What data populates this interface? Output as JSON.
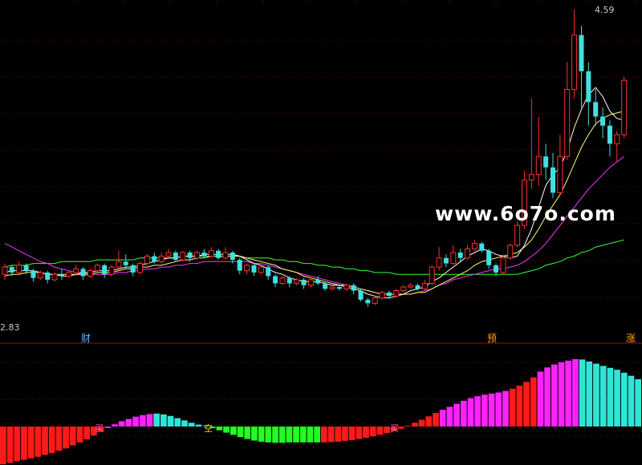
{
  "watermark": "www.6o7o.com",
  "labels": {
    "high": "4.59",
    "low": "2.83",
    "tag_cai": "财",
    "tag_yu": "预",
    "tag_zhang": "涨",
    "signal_buy_1": "买",
    "signal_empty": "空",
    "signal_buy_2": "买"
  },
  "colors": {
    "background": "#000000",
    "up": "#ff3030",
    "down": "#40e0e0",
    "ma_short": "#ffffff",
    "ma_mid": "#ffff66",
    "ma_long": "#ff33ff",
    "ma_very_long": "#33ff33",
    "separator": "#b00000",
    "gridline": "#800000",
    "bar_red": "#ff1a1a",
    "bar_magenta": "#ff22ff",
    "bar_cyan": "#2ee6d6",
    "bar_green": "#22ff22"
  },
  "chart_data": [
    {
      "type": "candlestick",
      "y_range": [
        2.83,
        4.59
      ],
      "grid": "dotted horizontal",
      "candles": [
        [
          3.13,
          3.17,
          3.19,
          3.1
        ],
        [
          3.17,
          3.14,
          3.18,
          3.12
        ],
        [
          3.14,
          3.18,
          3.2,
          3.13
        ],
        [
          3.18,
          3.15,
          3.19,
          3.13
        ],
        [
          3.15,
          3.11,
          3.16,
          3.09
        ],
        [
          3.11,
          3.14,
          3.15,
          3.1
        ],
        [
          3.14,
          3.1,
          3.15,
          3.08
        ],
        [
          3.1,
          3.13,
          3.14,
          3.09
        ],
        [
          3.13,
          3.12,
          3.16,
          3.1
        ],
        [
          3.12,
          3.14,
          3.15,
          3.11
        ],
        [
          3.14,
          3.16,
          3.18,
          3.12
        ],
        [
          3.16,
          3.12,
          3.17,
          3.1
        ],
        [
          3.12,
          3.15,
          3.16,
          3.11
        ],
        [
          3.15,
          3.18,
          3.19,
          3.14
        ],
        [
          3.18,
          3.13,
          3.19,
          3.11
        ],
        [
          3.13,
          3.17,
          3.18,
          3.12
        ],
        [
          3.17,
          3.2,
          3.26,
          3.15
        ],
        [
          3.2,
          3.18,
          3.24,
          3.16
        ],
        [
          3.18,
          3.14,
          3.19,
          3.12
        ],
        [
          3.14,
          3.19,
          3.2,
          3.13
        ],
        [
          3.19,
          3.23,
          3.24,
          3.18
        ],
        [
          3.23,
          3.2,
          3.25,
          3.19
        ],
        [
          3.2,
          3.23,
          3.25,
          3.19
        ],
        [
          3.23,
          3.25,
          3.27,
          3.22
        ],
        [
          3.25,
          3.21,
          3.26,
          3.2
        ],
        [
          3.21,
          3.25,
          3.26,
          3.2
        ],
        [
          3.25,
          3.22,
          3.26,
          3.2
        ],
        [
          3.22,
          3.25,
          3.26,
          3.21
        ],
        [
          3.25,
          3.23,
          3.27,
          3.22
        ],
        [
          3.23,
          3.26,
          3.28,
          3.22
        ],
        [
          3.26,
          3.22,
          3.27,
          3.21
        ],
        [
          3.22,
          3.25,
          3.28,
          3.21
        ],
        [
          3.25,
          3.21,
          3.26,
          3.19
        ],
        [
          3.21,
          3.15,
          3.22,
          3.13
        ],
        [
          3.15,
          3.18,
          3.19,
          3.13
        ],
        [
          3.18,
          3.14,
          3.19,
          3.12
        ],
        [
          3.14,
          3.17,
          3.18,
          3.13
        ],
        [
          3.17,
          3.12,
          3.18,
          3.1
        ],
        [
          3.12,
          3.08,
          3.13,
          3.06
        ],
        [
          3.08,
          3.11,
          3.12,
          3.07
        ],
        [
          3.11,
          3.08,
          3.12,
          3.06
        ],
        [
          3.08,
          3.1,
          3.11,
          3.07
        ],
        [
          3.1,
          3.07,
          3.11,
          3.05
        ],
        [
          3.07,
          3.1,
          3.11,
          3.06
        ],
        [
          3.1,
          3.08,
          3.12,
          3.07
        ],
        [
          3.08,
          3.05,
          3.09,
          3.04
        ],
        [
          3.05,
          3.06,
          3.07,
          3.04
        ],
        [
          3.06,
          3.05,
          3.07,
          3.04
        ],
        [
          3.05,
          3.07,
          3.08,
          3.04
        ],
        [
          3.07,
          3.04,
          3.08,
          3.02
        ],
        [
          3.04,
          2.99,
          3.05,
          2.98
        ],
        [
          2.99,
          2.97,
          3.0,
          2.95
        ],
        [
          2.97,
          3.0,
          3.01,
          2.96
        ],
        [
          3.0,
          3.03,
          3.04,
          2.99
        ],
        [
          3.03,
          3.01,
          3.04,
          3.0
        ],
        [
          3.01,
          3.04,
          3.05,
          3.0
        ],
        [
          3.04,
          3.06,
          3.07,
          3.03
        ],
        [
          3.06,
          3.07,
          3.08,
          3.05
        ],
        [
          3.07,
          3.05,
          3.08,
          3.04
        ],
        [
          3.05,
          3.08,
          3.1,
          3.04
        ],
        [
          3.08,
          3.17,
          3.18,
          3.07
        ],
        [
          3.17,
          3.22,
          3.28,
          3.15
        ],
        [
          3.22,
          3.19,
          3.24,
          3.17
        ],
        [
          3.19,
          3.25,
          3.29,
          3.18
        ],
        [
          3.25,
          3.22,
          3.27,
          3.2
        ],
        [
          3.22,
          3.27,
          3.29,
          3.21
        ],
        [
          3.27,
          3.3,
          3.32,
          3.26
        ],
        [
          3.3,
          3.26,
          3.31,
          3.25
        ],
        [
          3.26,
          3.18,
          3.27,
          3.16
        ],
        [
          3.18,
          3.14,
          3.19,
          3.12
        ],
        [
          3.14,
          3.22,
          3.24,
          3.13
        ],
        [
          3.22,
          3.29,
          3.3,
          3.21
        ],
        [
          3.29,
          3.4,
          3.42,
          3.28
        ],
        [
          3.4,
          3.65,
          3.7,
          3.38
        ],
        [
          3.65,
          3.68,
          4.1,
          3.6
        ],
        [
          3.68,
          3.78,
          4.0,
          3.62
        ],
        [
          3.78,
          3.72,
          3.85,
          3.65
        ],
        [
          3.72,
          3.58,
          3.8,
          3.55
        ],
        [
          3.58,
          3.78,
          3.9,
          3.56
        ],
        [
          3.78,
          4.15,
          4.3,
          3.76
        ],
        [
          4.15,
          4.45,
          4.59,
          4.1
        ],
        [
          4.45,
          4.25,
          4.5,
          4.05
        ],
        [
          4.25,
          4.08,
          4.3,
          3.95
        ],
        [
          4.08,
          4.0,
          4.15,
          3.95
        ],
        [
          4.0,
          3.95,
          4.05,
          3.88
        ],
        [
          3.95,
          3.85,
          3.98,
          3.78
        ],
        [
          3.85,
          3.9,
          3.92,
          3.75
        ],
        [
          3.9,
          4.2,
          4.22,
          3.88
        ]
      ],
      "ma_short": [
        3.14,
        3.15,
        3.15,
        3.15,
        3.15,
        3.14,
        3.13,
        3.13,
        3.12,
        3.12,
        3.13,
        3.14,
        3.14,
        3.15,
        3.15,
        3.15,
        3.16,
        3.17,
        3.17,
        3.18,
        3.19,
        3.2,
        3.21,
        3.22,
        3.22,
        3.23,
        3.23,
        3.23,
        3.24,
        3.24,
        3.24,
        3.24,
        3.24,
        3.23,
        3.21,
        3.19,
        3.18,
        3.16,
        3.14,
        3.13,
        3.11,
        3.1,
        3.09,
        3.09,
        3.09,
        3.08,
        3.07,
        3.07,
        3.06,
        3.05,
        3.04,
        3.02,
        3.01,
        3.0,
        3.0,
        3.01,
        3.02,
        3.04,
        3.05,
        3.06,
        3.09,
        3.11,
        3.14,
        3.17,
        3.2,
        3.23,
        3.25,
        3.27,
        3.26,
        3.24,
        3.23,
        3.22,
        3.23,
        3.29,
        3.38,
        3.5,
        3.62,
        3.68,
        3.72,
        3.81,
        3.94,
        4.04,
        4.12,
        4.16,
        4.11,
        4.03,
        3.99,
        3.98
      ],
      "ma_mid": [
        3.12,
        3.13,
        3.13,
        3.14,
        3.14,
        3.14,
        3.13,
        3.13,
        3.13,
        3.13,
        3.13,
        3.13,
        3.13,
        3.14,
        3.14,
        3.14,
        3.15,
        3.16,
        3.16,
        3.17,
        3.17,
        3.18,
        3.18,
        3.19,
        3.2,
        3.21,
        3.21,
        3.22,
        3.22,
        3.23,
        3.23,
        3.23,
        3.23,
        3.23,
        3.22,
        3.21,
        3.2,
        3.19,
        3.18,
        3.16,
        3.15,
        3.14,
        3.12,
        3.11,
        3.1,
        3.09,
        3.08,
        3.07,
        3.07,
        3.06,
        3.05,
        3.04,
        3.03,
        3.02,
        3.02,
        3.02,
        3.02,
        3.02,
        3.03,
        3.03,
        3.05,
        3.07,
        3.09,
        3.11,
        3.13,
        3.15,
        3.18,
        3.2,
        3.21,
        3.22,
        3.23,
        3.24,
        3.25,
        3.28,
        3.32,
        3.38,
        3.45,
        3.51,
        3.57,
        3.65,
        3.74,
        3.83,
        3.9,
        3.96,
        3.99,
        4.01,
        4.02,
        4.03
      ],
      "ma_long": [
        3.3,
        3.28,
        3.26,
        3.24,
        3.22,
        3.2,
        3.19,
        3.17,
        3.16,
        3.15,
        3.14,
        3.14,
        3.13,
        3.13,
        3.13,
        3.13,
        3.14,
        3.14,
        3.15,
        3.15,
        3.16,
        3.16,
        3.17,
        3.17,
        3.18,
        3.18,
        3.19,
        3.19,
        3.2,
        3.2,
        3.2,
        3.2,
        3.2,
        3.2,
        3.2,
        3.19,
        3.19,
        3.18,
        3.17,
        3.16,
        3.15,
        3.14,
        3.13,
        3.12,
        3.11,
        3.1,
        3.09,
        3.08,
        3.07,
        3.06,
        3.05,
        3.04,
        3.03,
        3.02,
        3.02,
        3.02,
        3.02,
        3.02,
        3.03,
        3.04,
        3.05,
        3.07,
        3.08,
        3.1,
        3.11,
        3.12,
        3.13,
        3.14,
        3.15,
        3.16,
        3.16,
        3.17,
        3.18,
        3.2,
        3.23,
        3.26,
        3.3,
        3.35,
        3.4,
        3.45,
        3.5,
        3.55,
        3.6,
        3.64,
        3.68,
        3.72,
        3.75,
        3.78
      ],
      "ma_very_long": [
        3.17,
        3.18,
        3.18,
        3.18,
        3.19,
        3.19,
        3.19,
        3.19,
        3.2,
        3.2,
        3.2,
        3.2,
        3.2,
        3.21,
        3.21,
        3.21,
        3.21,
        3.21,
        3.21,
        3.22,
        3.22,
        3.22,
        3.22,
        3.22,
        3.22,
        3.23,
        3.23,
        3.23,
        3.23,
        3.23,
        3.23,
        3.23,
        3.23,
        3.23,
        3.22,
        3.22,
        3.22,
        3.22,
        3.21,
        3.21,
        3.2,
        3.2,
        3.19,
        3.19,
        3.18,
        3.18,
        3.17,
        3.17,
        3.16,
        3.16,
        3.15,
        3.15,
        3.14,
        3.14,
        3.14,
        3.13,
        3.13,
        3.13,
        3.13,
        3.13,
        3.13,
        3.13,
        3.13,
        3.13,
        3.13,
        3.13,
        3.13,
        3.13,
        3.13,
        3.13,
        3.13,
        3.13,
        3.13,
        3.14,
        3.15,
        3.16,
        3.18,
        3.19,
        3.2,
        3.22,
        3.23,
        3.25,
        3.26,
        3.28,
        3.29,
        3.3,
        3.31,
        3.32
      ]
    },
    {
      "type": "bar",
      "y_range": [
        -100,
        180
      ],
      "bars": [
        {
          "v": -100,
          "c": "red"
        },
        {
          "v": -96,
          "c": "red"
        },
        {
          "v": -92,
          "c": "red"
        },
        {
          "v": -88,
          "c": "red"
        },
        {
          "v": -84,
          "c": "red"
        },
        {
          "v": -80,
          "c": "red"
        },
        {
          "v": -75,
          "c": "red"
        },
        {
          "v": -70,
          "c": "red"
        },
        {
          "v": -64,
          "c": "red"
        },
        {
          "v": -58,
          "c": "red"
        },
        {
          "v": -50,
          "c": "red"
        },
        {
          "v": -42,
          "c": "red"
        },
        {
          "v": -34,
          "c": "red"
        },
        {
          "v": -24,
          "c": "red"
        },
        {
          "v": -14,
          "c": "red"
        },
        {
          "v": -4,
          "c": "magenta"
        },
        {
          "v": 6,
          "c": "magenta"
        },
        {
          "v": 14,
          "c": "magenta"
        },
        {
          "v": 20,
          "c": "magenta"
        },
        {
          "v": 26,
          "c": "magenta"
        },
        {
          "v": 30,
          "c": "magenta"
        },
        {
          "v": 33,
          "c": "magenta"
        },
        {
          "v": 34,
          "c": "cyan"
        },
        {
          "v": 32,
          "c": "cyan"
        },
        {
          "v": 28,
          "c": "cyan"
        },
        {
          "v": 22,
          "c": "cyan"
        },
        {
          "v": 16,
          "c": "cyan"
        },
        {
          "v": 10,
          "c": "cyan"
        },
        {
          "v": 5,
          "c": "cyan"
        },
        {
          "v": 1,
          "c": "cyan"
        },
        {
          "v": -4,
          "c": "green"
        },
        {
          "v": -10,
          "c": "green"
        },
        {
          "v": -16,
          "c": "green"
        },
        {
          "v": -22,
          "c": "green"
        },
        {
          "v": -28,
          "c": "green"
        },
        {
          "v": -33,
          "c": "green"
        },
        {
          "v": -37,
          "c": "green"
        },
        {
          "v": -40,
          "c": "green"
        },
        {
          "v": -42,
          "c": "green"
        },
        {
          "v": -43,
          "c": "green"
        },
        {
          "v": -43,
          "c": "green"
        },
        {
          "v": -42,
          "c": "green"
        },
        {
          "v": -42,
          "c": "green"
        },
        {
          "v": -42,
          "c": "green"
        },
        {
          "v": -42,
          "c": "green"
        },
        {
          "v": -42,
          "c": "green"
        },
        {
          "v": -42,
          "c": "red"
        },
        {
          "v": -41,
          "c": "red"
        },
        {
          "v": -40,
          "c": "red"
        },
        {
          "v": -38,
          "c": "red"
        },
        {
          "v": -36,
          "c": "red"
        },
        {
          "v": -33,
          "c": "red"
        },
        {
          "v": -30,
          "c": "red"
        },
        {
          "v": -26,
          "c": "red"
        },
        {
          "v": -22,
          "c": "red"
        },
        {
          "v": -17,
          "c": "red"
        },
        {
          "v": -12,
          "c": "red"
        },
        {
          "v": -6,
          "c": "red"
        },
        {
          "v": 2,
          "c": "red"
        },
        {
          "v": 10,
          "c": "red"
        },
        {
          "v": 18,
          "c": "red"
        },
        {
          "v": 27,
          "c": "red"
        },
        {
          "v": 36,
          "c": "red"
        },
        {
          "v": 44,
          "c": "magenta"
        },
        {
          "v": 52,
          "c": "magenta"
        },
        {
          "v": 60,
          "c": "magenta"
        },
        {
          "v": 68,
          "c": "magenta"
        },
        {
          "v": 75,
          "c": "magenta"
        },
        {
          "v": 80,
          "c": "magenta"
        },
        {
          "v": 84,
          "c": "magenta"
        },
        {
          "v": 87,
          "c": "magenta"
        },
        {
          "v": 90,
          "c": "magenta"
        },
        {
          "v": 94,
          "c": "magenta"
        },
        {
          "v": 100,
          "c": "red"
        },
        {
          "v": 108,
          "c": "red"
        },
        {
          "v": 118,
          "c": "red"
        },
        {
          "v": 130,
          "c": "red"
        },
        {
          "v": 145,
          "c": "magenta"
        },
        {
          "v": 156,
          "c": "magenta"
        },
        {
          "v": 164,
          "c": "magenta"
        },
        {
          "v": 170,
          "c": "magenta"
        },
        {
          "v": 174,
          "c": "magenta"
        },
        {
          "v": 178,
          "c": "magenta"
        },
        {
          "v": 177,
          "c": "cyan"
        },
        {
          "v": 172,
          "c": "cyan"
        },
        {
          "v": 166,
          "c": "cyan"
        },
        {
          "v": 160,
          "c": "cyan"
        },
        {
          "v": 155,
          "c": "cyan"
        },
        {
          "v": 150,
          "c": "cyan"
        },
        {
          "v": 142,
          "c": "cyan"
        },
        {
          "v": 134,
          "c": "cyan"
        },
        {
          "v": 125,
          "c": "cyan"
        }
      ]
    }
  ]
}
